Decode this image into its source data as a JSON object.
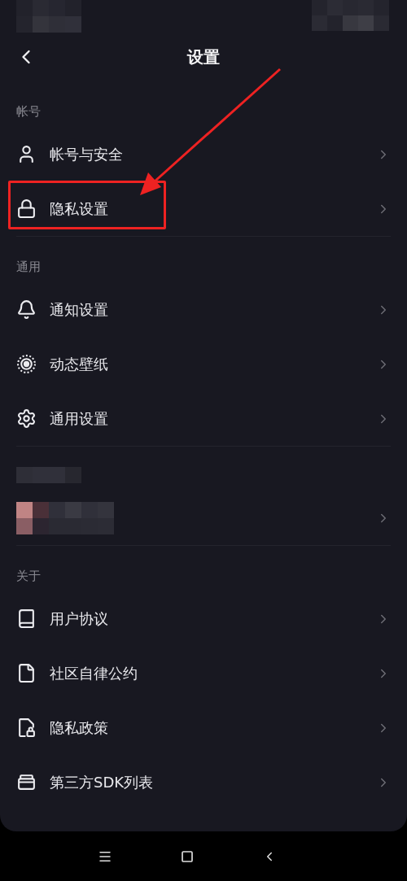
{
  "title": "设置",
  "sections": [
    {
      "kind": "list",
      "label": "帐号",
      "items": [
        {
          "label": "帐号与安全"
        },
        {
          "label": "隐私设置"
        }
      ]
    },
    {
      "kind": "list",
      "label": "通用",
      "items": [
        {
          "label": "通知设置"
        },
        {
          "label": "动态壁纸"
        },
        {
          "label": "通用设置"
        }
      ]
    },
    {
      "kind": "redacted"
    },
    {
      "kind": "list",
      "label": "关于",
      "items": [
        {
          "label": "用户协议"
        },
        {
          "label": "社区自律公约"
        },
        {
          "label": "隐私政策"
        },
        {
          "label": "第三方SDK列表"
        }
      ]
    }
  ]
}
